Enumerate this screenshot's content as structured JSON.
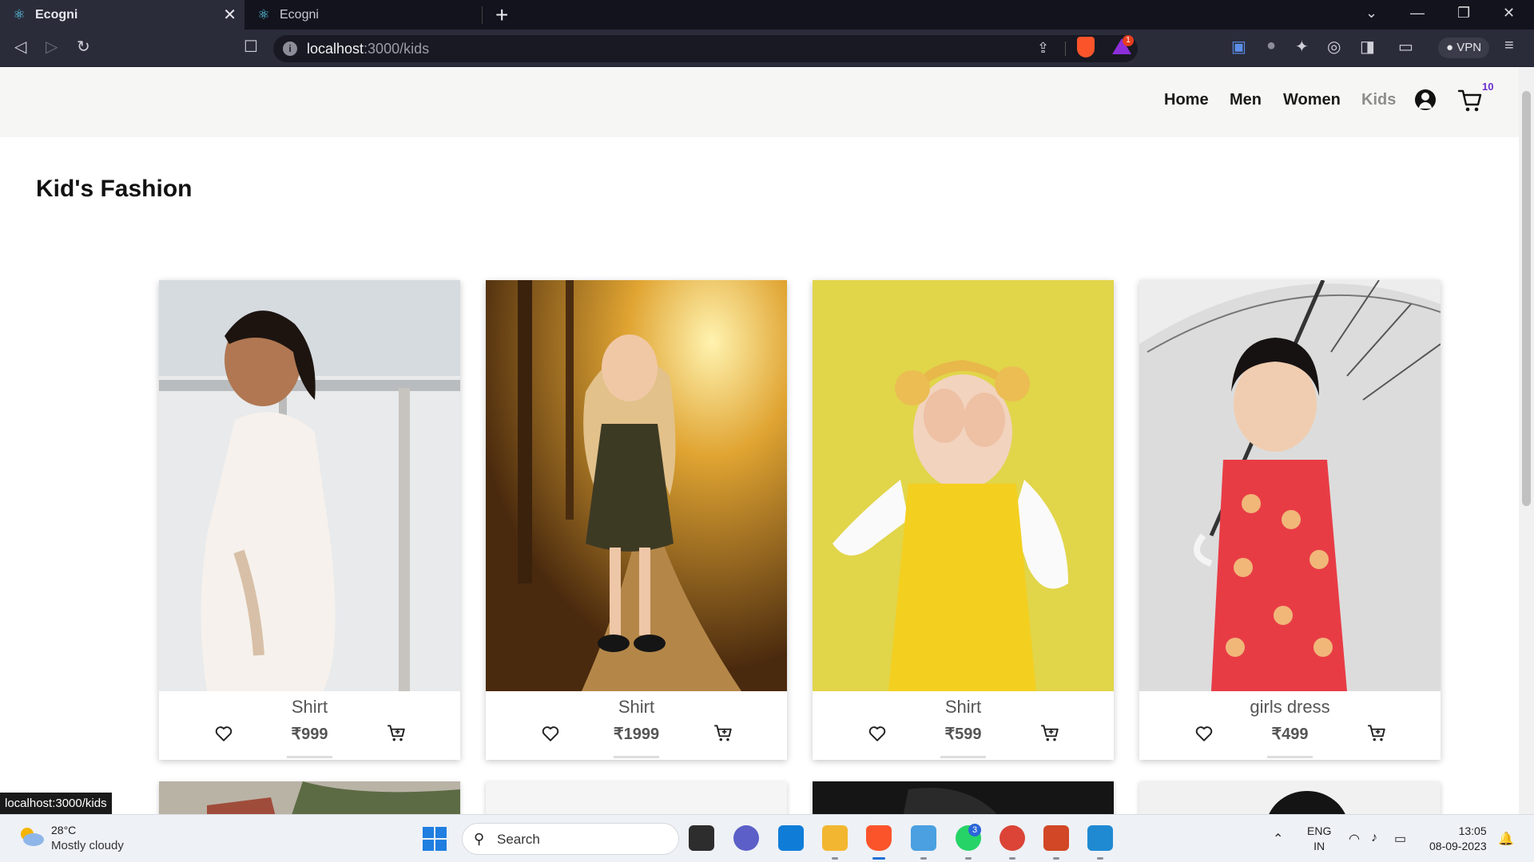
{
  "browser": {
    "tabs": [
      {
        "title": "Ecogni",
        "active": true
      },
      {
        "title": "Ecogni",
        "active": false
      }
    ],
    "url_host": "localhost",
    "url_path": ":3000/kids",
    "brave_badge": "1",
    "vpn_label": "VPN",
    "status_url": "localhost:3000/kids"
  },
  "nav": {
    "links": [
      "Home",
      "Men",
      "Women",
      "Kids"
    ],
    "cart_count": "10"
  },
  "page": {
    "title": "Kid's Fashion"
  },
  "products": [
    {
      "name": "Shirt",
      "price": "₹999"
    },
    {
      "name": "Shirt",
      "price": "₹1999"
    },
    {
      "name": "Shirt",
      "price": "₹599"
    },
    {
      "name": "girls dress",
      "price": "₹499"
    }
  ],
  "taskbar": {
    "temperature": "28°C",
    "weather": "Mostly cloudy",
    "search_placeholder": "Search",
    "whatsapp_badge": "3",
    "lang_top": "ENG",
    "lang_bottom": "IN",
    "time": "13:05",
    "date": "08-09-2023"
  },
  "colors": {
    "chrome_dark": "#12131c",
    "chrome_toolbar": "#2a2c3a",
    "navbar_bg": "#f6f6f4",
    "cart_badge": "#6a2fd1",
    "brave_orange": "#fb542b"
  }
}
